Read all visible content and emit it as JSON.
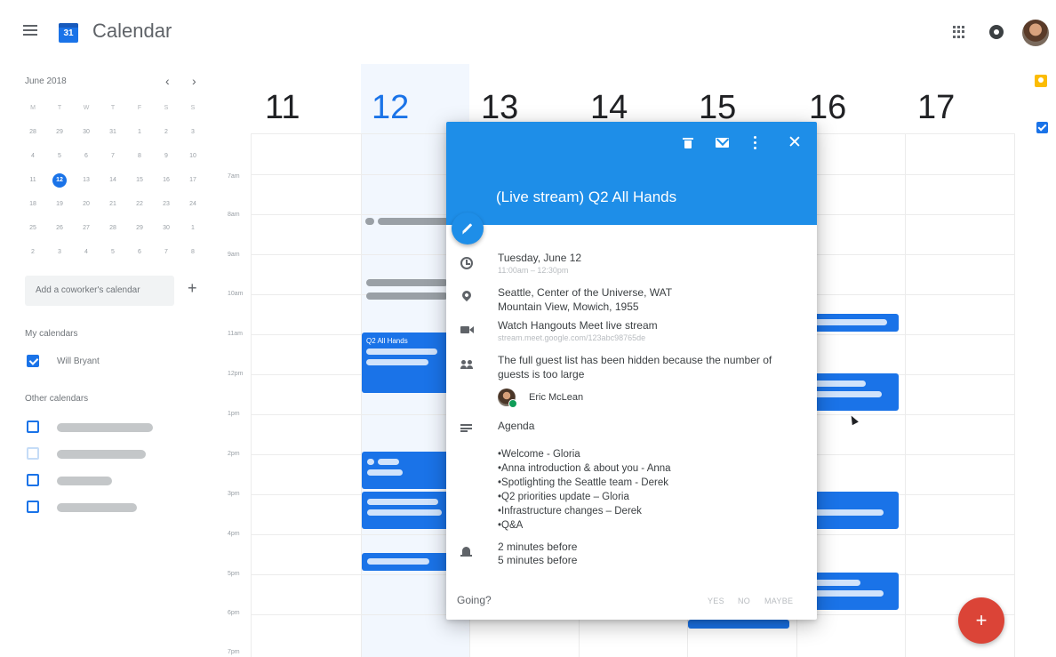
{
  "header": {
    "app_title": "Calendar",
    "logo_day": "31",
    "icons": [
      "menu-icon",
      "calendar-logo-icon",
      "apps-grid-icon",
      "notifications-icon",
      "account-avatar"
    ]
  },
  "mini_calendar": {
    "month": "June 2018",
    "prev": "‹",
    "next": "›",
    "weekdays": [
      "M",
      "T",
      "W",
      "T",
      "F",
      "S",
      "S"
    ],
    "rows": [
      [
        "28",
        "29",
        "30",
        "31",
        "1",
        "2",
        "3"
      ],
      [
        "4",
        "5",
        "6",
        "7",
        "8",
        "9",
        "10"
      ],
      [
        "11",
        "12",
        "13",
        "14",
        "15",
        "16",
        "17"
      ],
      [
        "18",
        "19",
        "20",
        "21",
        "22",
        "23",
        "24"
      ],
      [
        "25",
        "26",
        "27",
        "28",
        "29",
        "30",
        "1"
      ],
      [
        "2",
        "3",
        "4",
        "5",
        "6",
        "7",
        "8"
      ]
    ],
    "today": "12"
  },
  "sidebar": {
    "add_coworker_placeholder": "Add a coworker's calendar",
    "add_plus": "+",
    "my_calendars_heading": "My calendars",
    "my_calendars": [
      {
        "label": "Will Bryant",
        "checked": true
      }
    ],
    "other_calendars_heading": "Other calendars"
  },
  "week": {
    "days": [
      "11",
      "12",
      "13",
      "14",
      "15",
      "16",
      "17"
    ],
    "today": "12",
    "times": [
      "7am",
      "8am",
      "9am",
      "10am",
      "11am",
      "12pm",
      "1pm",
      "2pm",
      "3pm",
      "4pm",
      "5pm",
      "6pm",
      "7pm"
    ],
    "visible_event_title": "Q2 All Hands"
  },
  "popup": {
    "title": "(Live stream) Q2 All Hands",
    "date": "Tuesday, June 12",
    "time": "11:00am – 12:30pm",
    "location_line1": "Seattle, Center of the Universe, WAT",
    "location_line2": "Mountain View, Mowich, 1955",
    "stream_label": "Watch Hangouts Meet live stream",
    "stream_url": "stream.meet.google.com/123abc98765de",
    "guests_note": "The full guest list has been hidden because the number of guests is too large",
    "guest_name": "Eric McLean",
    "agenda_heading": "Agenda",
    "agenda_items": [
      "Welcome - Gloria",
      "Anna introduction & about you - Anna",
      "Spotlighting the Seattle team - Derek",
      "Q2 priorities update – Gloria",
      "Infrastructure changes – Derek",
      "Q&A"
    ],
    "reminders": [
      "2 minutes before",
      "5 minutes before"
    ],
    "going_label": "Going?",
    "rsvp": {
      "yes": "YES",
      "no": "NO",
      "maybe": "MAYBE"
    },
    "header_color": "#1e8ee8",
    "icons": [
      "delete-icon",
      "email-icon",
      "more-options-icon",
      "close-icon",
      "edit-icon",
      "clock-icon",
      "location-icon",
      "video-icon",
      "guests-icon",
      "description-icon",
      "bell-icon"
    ]
  },
  "fab": {
    "label": "+"
  },
  "colors": {
    "accent": "#1a73e8",
    "event": "#1a73e8",
    "fab": "#db4437",
    "today_column": "#e8f0fe"
  }
}
